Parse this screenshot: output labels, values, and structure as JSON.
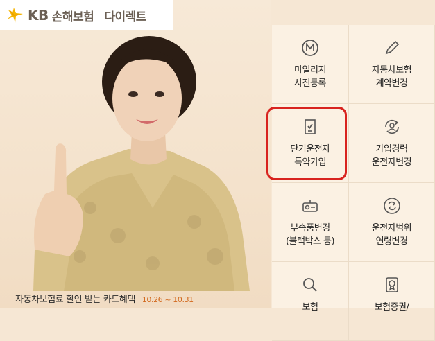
{
  "logo": {
    "brand": "KB",
    "name": "손해보험",
    "sub": "다이렉트"
  },
  "promo": {
    "text": "자동차보험료 할인 받는 카드혜택",
    "date": "10.26 ~ 10.31"
  },
  "menu": {
    "items": [
      {
        "label": "마일리지\n사진등록",
        "icon": "mileage-icon"
      },
      {
        "label": "자동차보험\n계약변경",
        "icon": "pencil-icon"
      },
      {
        "label": "단기운전자\n특약가입",
        "icon": "checklist-document-icon"
      },
      {
        "label": "가입경력\n운전자변경",
        "icon": "driver-change-icon"
      },
      {
        "label": "부속품변경\n(블랙박스 등)",
        "icon": "dashcam-icon"
      },
      {
        "label": "운전자범위\n연령변경",
        "icon": "refresh-icon"
      },
      {
        "label": "보험",
        "icon": "search-icon"
      },
      {
        "label": "보험증권/",
        "icon": "certificate-icon"
      }
    ]
  },
  "colors": {
    "highlight": "#d8231f",
    "logo_star": "#f5b400",
    "promo_date": "#d2691e"
  }
}
